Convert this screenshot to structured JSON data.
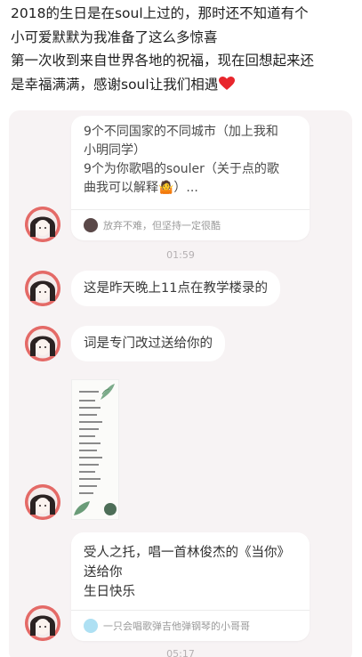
{
  "post": {
    "lines": [
      "2018的生日是在soul上过的，那时还不知道有个",
      "小可爱默默为我准备了这么多惊喜",
      "第一次收到来自世界各地的祝福，现在回想起来还",
      "是幸福满满，感谢soul让我们相遇"
    ],
    "heart_icon": "red-heart-emoji"
  },
  "chat": {
    "card1": {
      "lines": [
        "9个不同国家的不同城市（加上我和",
        "小明同学）",
        "9个为你歌唱的souler（关于点的歌",
        "曲我可以解释🤷）..."
      ],
      "signature": "放弃不难，但坚持一定很酷"
    },
    "time1": "01:59",
    "bubble1": "这是昨天晚上11点在教学楼录的",
    "bubble2": "词是专门改过送给你的",
    "photo_icon": "lyrics-sheet-photo",
    "card2": {
      "lines": [
        "受人之托，唱一首林俊杰的《当你》",
        "送给你",
        "生日快乐"
      ],
      "signature": "一只会唱歌弹吉他弹钢琴的小哥哥"
    },
    "time2": "05:17"
  },
  "colors": {
    "chat_background": "#f7f3f4",
    "avatar_ring": "#e46a67",
    "heart": "#e8262c"
  }
}
